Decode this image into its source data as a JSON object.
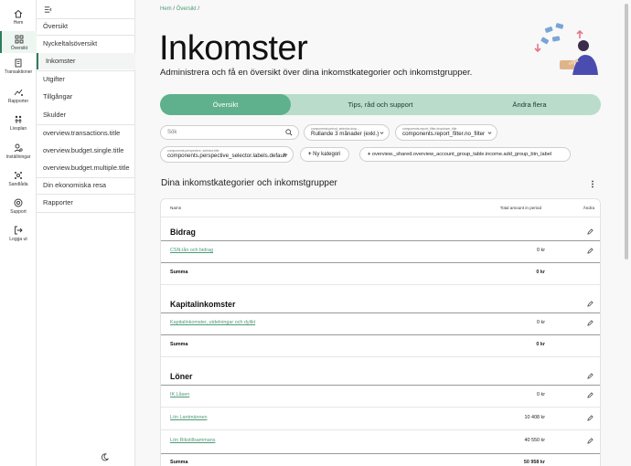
{
  "rail": [
    {
      "label": "Hem",
      "icon": "home-icon"
    },
    {
      "label": "Översikt",
      "icon": "dashboard-icon",
      "active": true
    },
    {
      "label": "Transaktioner",
      "icon": "receipt-icon"
    },
    {
      "label": "Rapporter",
      "icon": "chart-icon"
    },
    {
      "label": "Livsplan",
      "icon": "life-plan-icon"
    },
    {
      "label": "Inställningar",
      "icon": "settings-icon"
    },
    {
      "label": "Sandlåda",
      "icon": "sandbox-icon"
    },
    {
      "label": "Support",
      "icon": "support-icon"
    },
    {
      "label": "Logga ut",
      "icon": "logout-icon"
    }
  ],
  "nav": {
    "items": [
      {
        "label": "Översikt"
      },
      {
        "label": "Nyckeltalsöversikt"
      },
      {
        "label": "Inkomster",
        "active": true
      },
      {
        "label": "Utgifter"
      },
      {
        "label": "Tillgångar"
      },
      {
        "label": "Skulder"
      },
      {
        "label": "overview.transactions.title"
      },
      {
        "label": "overview.budget.single.title"
      },
      {
        "label": "overview.budget.multiple.title"
      },
      {
        "label": "Din ekonomiska resa"
      },
      {
        "label": "Rapporter"
      }
    ]
  },
  "breadcrumb": {
    "home": "Hem",
    "overview": "Översikt",
    "sep": "/"
  },
  "page": {
    "title": "Inkomster",
    "subtitle": "Administrera och få en översikt över dina inkomstkategorier och inkomstgrupper."
  },
  "tabs": [
    {
      "label": "Översikt",
      "active": true
    },
    {
      "label": "Tips, råd och support"
    },
    {
      "label": "Ändra flera"
    }
  ],
  "filters": {
    "search_placeholder": "Sök",
    "period_label": "components.period_selector.drop...",
    "period_value": "Rullande 3 månader (exkl.)",
    "report_label": "components.report_filter.dropdown_title",
    "report_value": "components.report_filter.no_filter",
    "perspective_label": "components.perspective_selector.title",
    "perspective_value": "components.perspective_selector.labels.default",
    "new_category": "Ny kategori",
    "add_group": "overview._shared.overview_account_group_table.income.add_group_btn_label"
  },
  "section": {
    "title": "Dina inkomstkategorier och inkomstgrupper"
  },
  "table": {
    "headers": {
      "name": "Namn",
      "amount": "Total amount in period",
      "edit": "Ändra"
    },
    "summa_label": "Summa",
    "groups": [
      {
        "title": "Bidrag",
        "rows": [
          {
            "name": "CSN-lån och bidrag",
            "amount": "0 kr"
          }
        ],
        "summa": "0 kr"
      },
      {
        "title": "Kapitalinkomster",
        "rows": [
          {
            "name": "Kapitalinkomster, utdelningar och dylikt",
            "amount": "0 kr"
          }
        ],
        "summa": "0 kr"
      },
      {
        "title": "Löner",
        "rows": [
          {
            "name": "IK Låsen",
            "amount": "0 kr"
          },
          {
            "name": "Lön Lantmännen",
            "amount": "10 408 kr"
          },
          {
            "name": "Lön Rikstillsammans",
            "amount": "40 550 kr"
          }
        ],
        "summa": "50 958 kr"
      }
    ]
  },
  "colors": {
    "accent": "#5fb08d",
    "accent_light": "#b9dccb",
    "link": "#4e9a78"
  }
}
